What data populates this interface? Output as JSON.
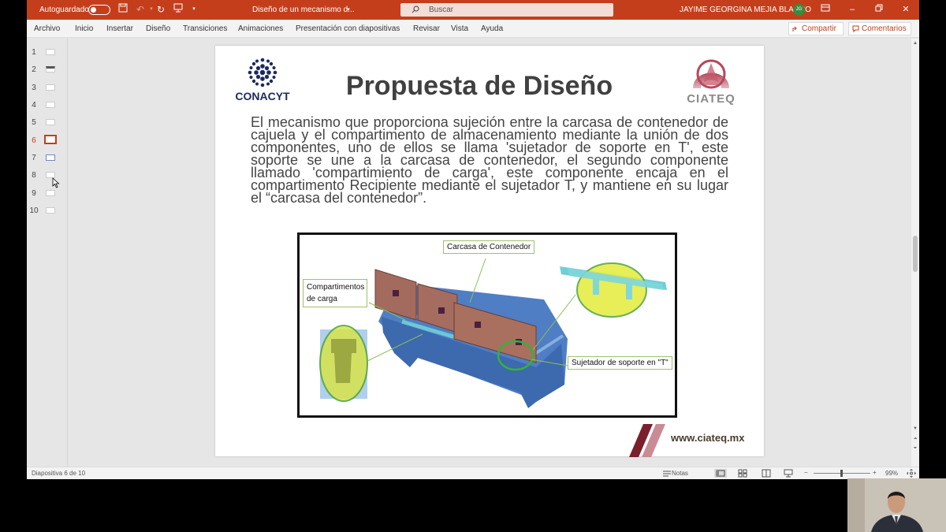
{
  "titlebar": {
    "autosave_label": "Autoguardado",
    "doc_title": "Diseño de un mecanismo d...",
    "search_placeholder": "Buscar",
    "user_name": "JAYIME GEORGINA MEJIA BLANCO",
    "user_initials": "JG"
  },
  "menu": {
    "items": [
      "Archivo",
      "Inicio",
      "Insertar",
      "Diseño",
      "Transiciones",
      "Animaciones",
      "Presentación con diapositivas",
      "Revisar",
      "Vista",
      "Ayuda"
    ],
    "share_label": "Compartir",
    "comments_label": "Comentarios"
  },
  "thumbnails": {
    "numbers": [
      "1",
      "2",
      "3",
      "4",
      "5",
      "6",
      "7",
      "8",
      "9",
      "10"
    ],
    "active_index": 6
  },
  "slide": {
    "logo_left_text": "CONACYT",
    "logo_right_text": "CIATEQ",
    "title": "Propuesta de Diseño",
    "body": "El mecanismo que proporciona sujeción entre la carcasa de contenedor de cajuela y el compartimento de almacenamiento mediante la unión de dos componentes, uno de ellos se llama 'sujetador de soporte en T', este soporte se une a la carcasa de contenedor, el segundo componente llamado 'compartimiento de carga', este componente encaja en el compartimento Recipiente mediante el sujetador T, y mantiene en su lugar el “carcasa del contenedor”.",
    "figure": {
      "callout_housing": "Carcasa de Contenedor",
      "callout_compartments": "Compartimentos de carga",
      "callout_fastener": "Sujetador de soporte en \"T\""
    },
    "footer_url": "www.ciateq.mx"
  },
  "statusbar": {
    "slide_info": "Diapositiva 6 de 10",
    "notes_label": "Notas",
    "zoom_minus": "−",
    "zoom_plus": "+",
    "zoom_level": "99%"
  },
  "colors": {
    "accent": "#c43e1c",
    "highlight_ellipse": "#e3ec3a",
    "housing_blue": "#5b86c8",
    "conacyt_navy": "#1c2a5c",
    "ciateq_maroon": "#7a1f2b"
  }
}
